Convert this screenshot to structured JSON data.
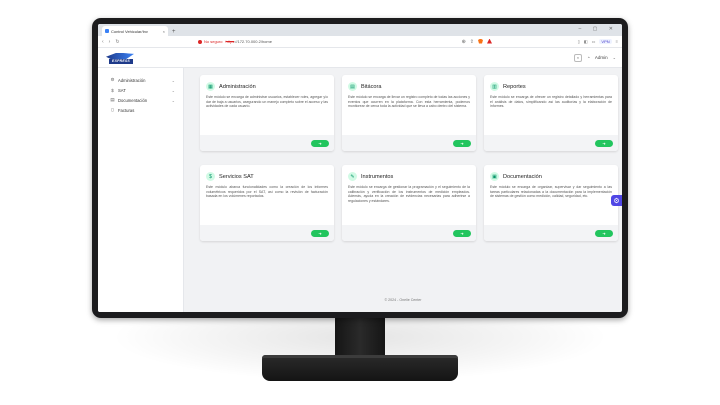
{
  "browser": {
    "tab_title": "Control Vehicular/Inv",
    "new_tab": "+",
    "window_controls": "–  ▢  ✕",
    "nav": [
      "‹",
      "›",
      "↻"
    ],
    "insecure_label": "No seguro",
    "url_scheme": "https",
    "url_rest": "://172.70.000.2/home",
    "vpn_label": "VPN"
  },
  "app": {
    "logo_text": "EXPRESS",
    "user_label": "Admin",
    "sidebar": [
      {
        "icon": "gear-icon",
        "glyph": "⚙",
        "label": "Administración",
        "chevron": "⌄"
      },
      {
        "icon": "dollar-icon",
        "glyph": "$",
        "label": "SAT",
        "chevron": "⌄"
      },
      {
        "icon": "document-icon",
        "glyph": "▤",
        "label": "Documentación",
        "chevron": "⌄"
      },
      {
        "icon": "invoice-icon",
        "glyph": "▯",
        "label": "Facturas",
        "chevron": ""
      }
    ],
    "cards": [
      {
        "icon": "grid-icon",
        "glyph": "▦",
        "title": "Administración",
        "desc": "Este módulo se encarga de administrar usuarios, establecer roles, agregar y/o dar de baja a usuarios, asegurando un manejo completo sobre el acceso y las actividades de cada usuario.",
        "button": "➜"
      },
      {
        "icon": "book-icon",
        "glyph": "▤",
        "title": "Bitácora",
        "desc": "Este módulo se encarga de llevar un registro completo de todas las acciones y eventos que ocurren en la plataforma. Con esta herramienta, podemos monitorear de cerca toda la actividad que se lleva a cabo dentro del sistema.",
        "button": "➜"
      },
      {
        "icon": "chart-icon",
        "glyph": "▥",
        "title": "Reportes",
        "desc": "Este módulo se encarga de ofrecer un registro detallado y herramientas para el análisis de datos, simplificando así las auditorías y la elaboración de informes.",
        "button": "➜"
      },
      {
        "icon": "dollar-icon",
        "glyph": "$",
        "title": "Servicios SAT",
        "desc": "Este módulo abarca funcionalidades como la creación de los informes volumétricos requeridos por el SAT, así como la revisión de facturación basada en los volúmenes reportados.",
        "button": "➜"
      },
      {
        "icon": "wrench-icon",
        "glyph": "✎",
        "title": "Instrumentos",
        "desc": "Este módulo se encarga de gestionar la programación y el seguimiento de la calibración y verificación de los instrumentos de medición empleados. Además, ayuda en la creación de evidencias necesarias para adherirse a regulaciones y estándares.",
        "button": "➜"
      },
      {
        "icon": "folder-icon",
        "glyph": "▣",
        "title": "Documentación",
        "desc": "Este módulo se encarga de organizar, supervisar y dar seguimiento a las tareas particulares relacionadas a la documentación para la implementación de sistemas de gestión como medición, calidad, seguridad, etc.",
        "button": "➜"
      }
    ],
    "settings_glyph": "⚙",
    "footer": "© 2024 - Onelie Center"
  },
  "colors": {
    "accent_green": "#22c55e",
    "icon_bg": "#d1fae5",
    "settings": "#4f46e5"
  }
}
